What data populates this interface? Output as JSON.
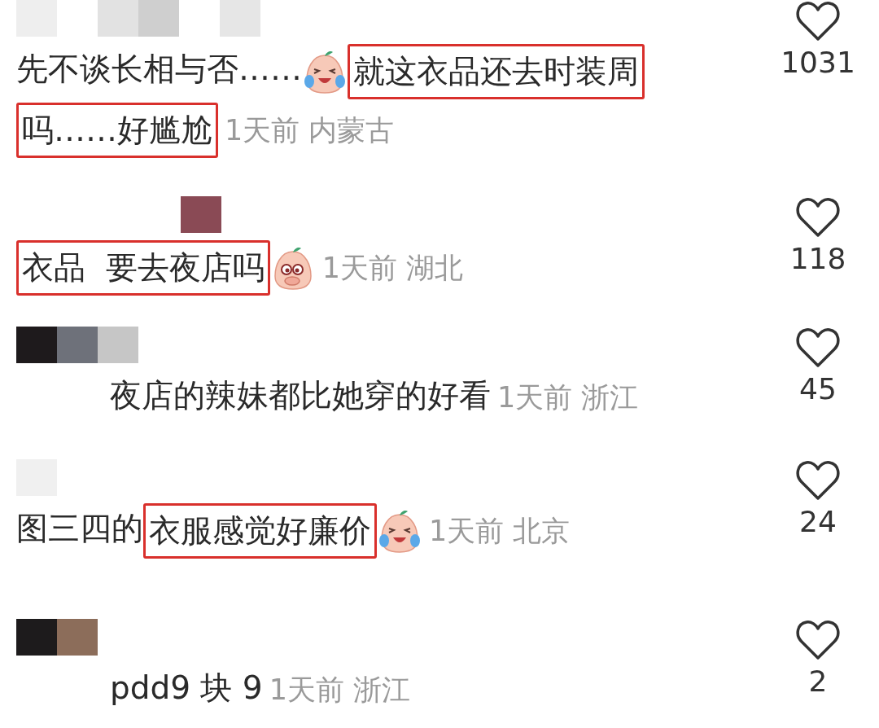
{
  "comments": [
    {
      "kind": "comment",
      "segments": [
        {
          "kind": "text",
          "text": "先不谈长相与否……",
          "highlighted": false
        },
        {
          "kind": "emoji-laughing"
        },
        {
          "kind": "text",
          "text": "就这衣品还去时装周",
          "highlighted": true
        },
        {
          "kind": "text",
          "text": "吗……好尴尬",
          "highlighted": true
        }
      ],
      "meta": "1天前 内蒙古",
      "likes": "1031"
    },
    {
      "kind": "comment",
      "segments": [
        {
          "kind": "text",
          "text": "衣品  要去夜店吗",
          "highlighted": true
        },
        {
          "kind": "emoji-shy"
        }
      ],
      "meta": "1天前 湖北",
      "likes": "118"
    },
    {
      "kind": "reply",
      "segments": [
        {
          "kind": "text",
          "text": "夜店的辣妹都比她穿的好看",
          "highlighted": false
        }
      ],
      "meta": "1天前 浙江",
      "likes": "45"
    },
    {
      "kind": "comment",
      "segments": [
        {
          "kind": "text",
          "text": "图三四的",
          "highlighted": false
        },
        {
          "kind": "text",
          "text": "衣服感觉好廉价",
          "highlighted": true
        },
        {
          "kind": "emoji-laughing"
        }
      ],
      "meta": "1天前 北京",
      "likes": "24"
    },
    {
      "kind": "reply",
      "segments": [
        {
          "kind": "text",
          "text": "pdd9 块 9",
          "highlighted": false
        }
      ],
      "meta": "1天前 浙江",
      "likes": "2"
    }
  ]
}
